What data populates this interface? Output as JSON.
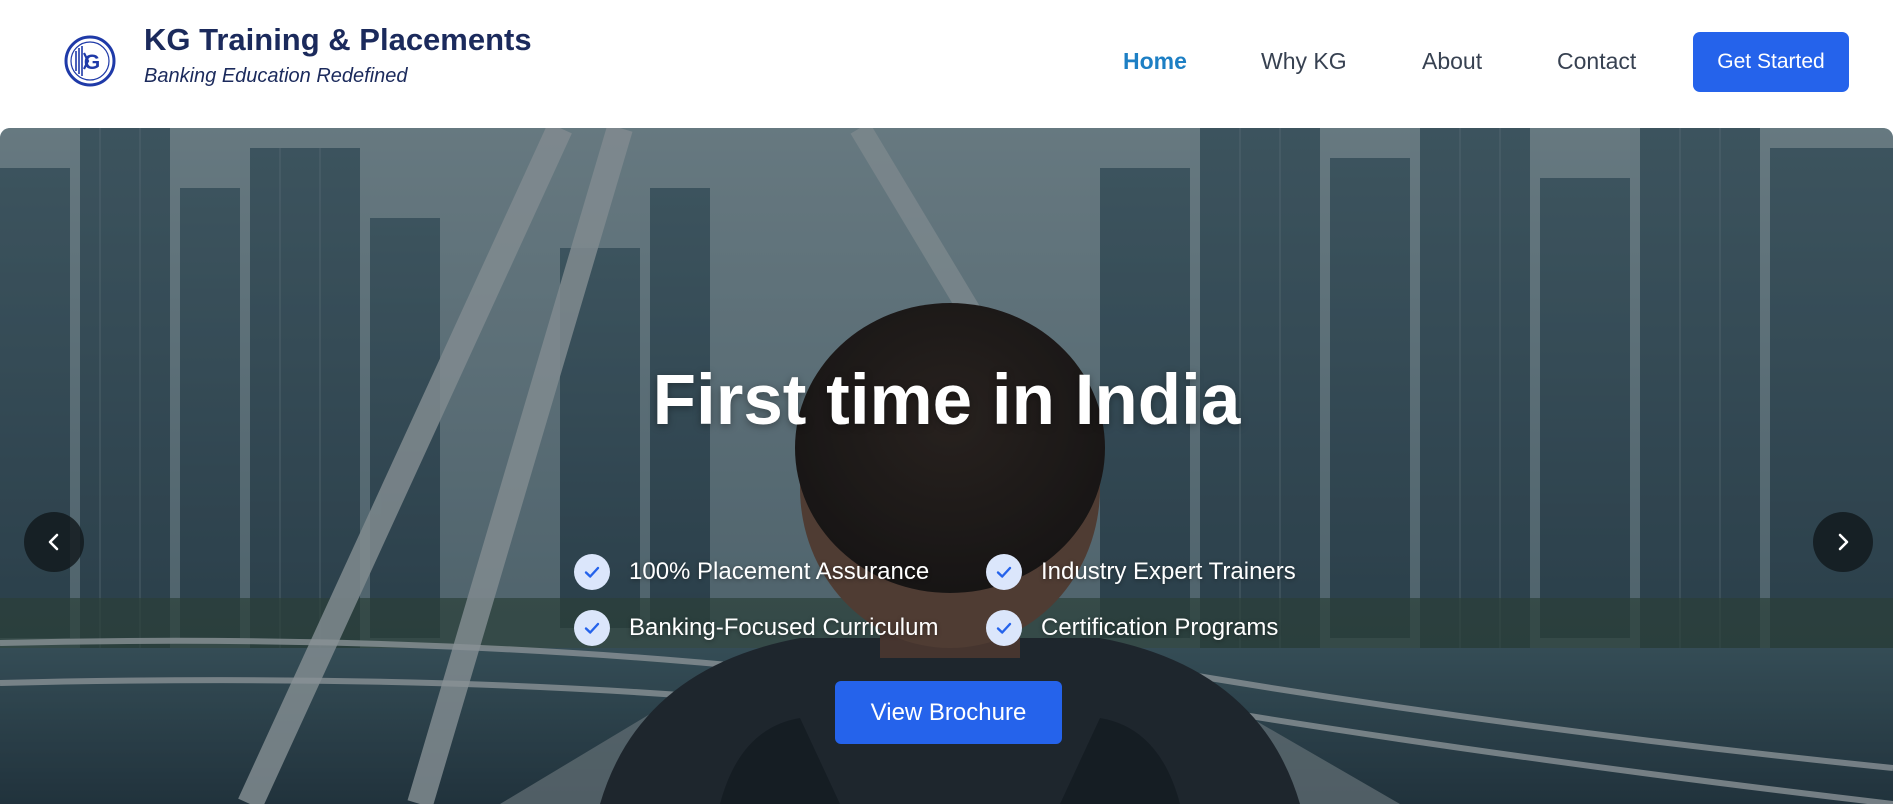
{
  "header": {
    "logo_icon": "kg-circle-logo-icon",
    "brand_title": "KG Training & Placements",
    "brand_tagline": "Banking Education Redefined",
    "nav": [
      {
        "label": "Home",
        "active": true
      },
      {
        "label": "Why KG",
        "active": false
      },
      {
        "label": "About",
        "active": false
      },
      {
        "label": "Contact",
        "active": false
      }
    ],
    "cta_label": "Get Started"
  },
  "hero": {
    "heading": "First time in India",
    "features": [
      {
        "label": "100% Placement Assurance",
        "icon": "check-icon"
      },
      {
        "label": "Industry Expert Trainers",
        "icon": "check-icon"
      },
      {
        "label": "Banking-Focused Curriculum",
        "icon": "check-icon"
      },
      {
        "label": "Certification Programs",
        "icon": "check-icon"
      }
    ],
    "brochure_label": "View Brochure",
    "prev_icon": "chevron-left-icon",
    "next_icon": "chevron-right-icon"
  },
  "colors": {
    "brand_navy": "#1b2a5c",
    "active_nav": "#1d7fc4",
    "primary_button": "#2563eb",
    "check_badge": "#dbe6fb"
  }
}
